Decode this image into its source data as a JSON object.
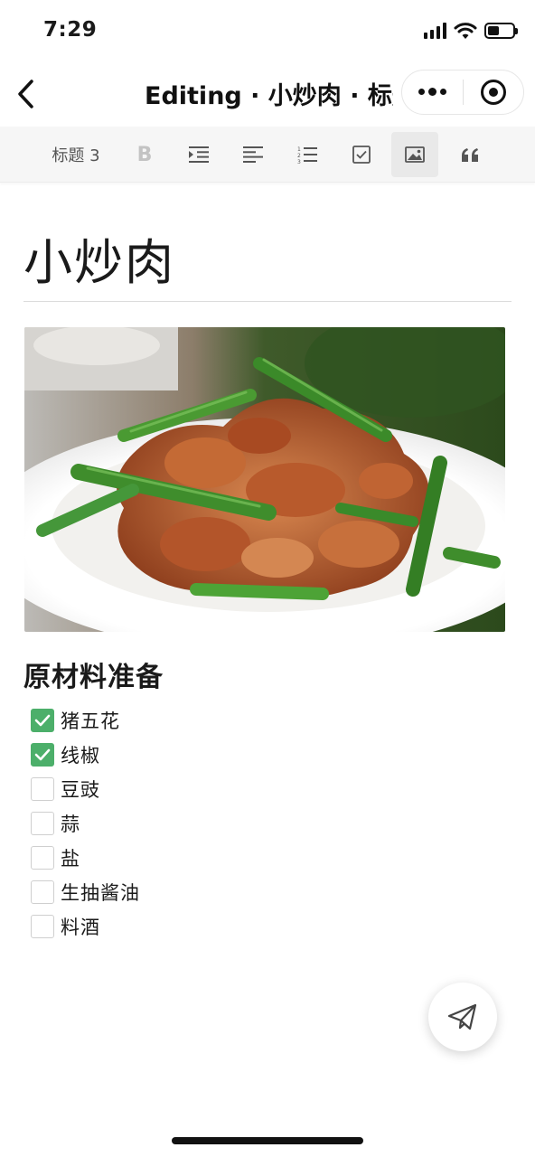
{
  "status_bar": {
    "time": "7:29",
    "battery_level": 0.45
  },
  "nav": {
    "title": "Editing · 小炒肉 · 标题",
    "back_icon": "chevron-left-icon",
    "more_icon": "more-dots-icon",
    "close_icon": "target-circle-icon"
  },
  "toolbar": {
    "heading_label": "标题 3",
    "bold_label": "B",
    "items": [
      {
        "name": "indent-icon"
      },
      {
        "name": "align-left-icon"
      },
      {
        "name": "ordered-list-icon"
      },
      {
        "name": "checkbox-icon"
      },
      {
        "name": "image-icon",
        "active": true
      },
      {
        "name": "quote-icon"
      }
    ]
  },
  "document": {
    "title": "小炒肉",
    "image_alt": "小炒肉",
    "section_heading": "原材料准备",
    "checklist": [
      {
        "label": "猪五花",
        "checked": true
      },
      {
        "label": "线椒",
        "checked": true
      },
      {
        "label": "豆豉",
        "checked": false
      },
      {
        "label": "蒜",
        "checked": false
      },
      {
        "label": "盐",
        "checked": false
      },
      {
        "label": "生抽酱油",
        "checked": false
      },
      {
        "label": "料酒",
        "checked": false
      }
    ]
  },
  "colors": {
    "check_green": "#4caf6a",
    "toolbar_bg": "#f6f6f6"
  }
}
